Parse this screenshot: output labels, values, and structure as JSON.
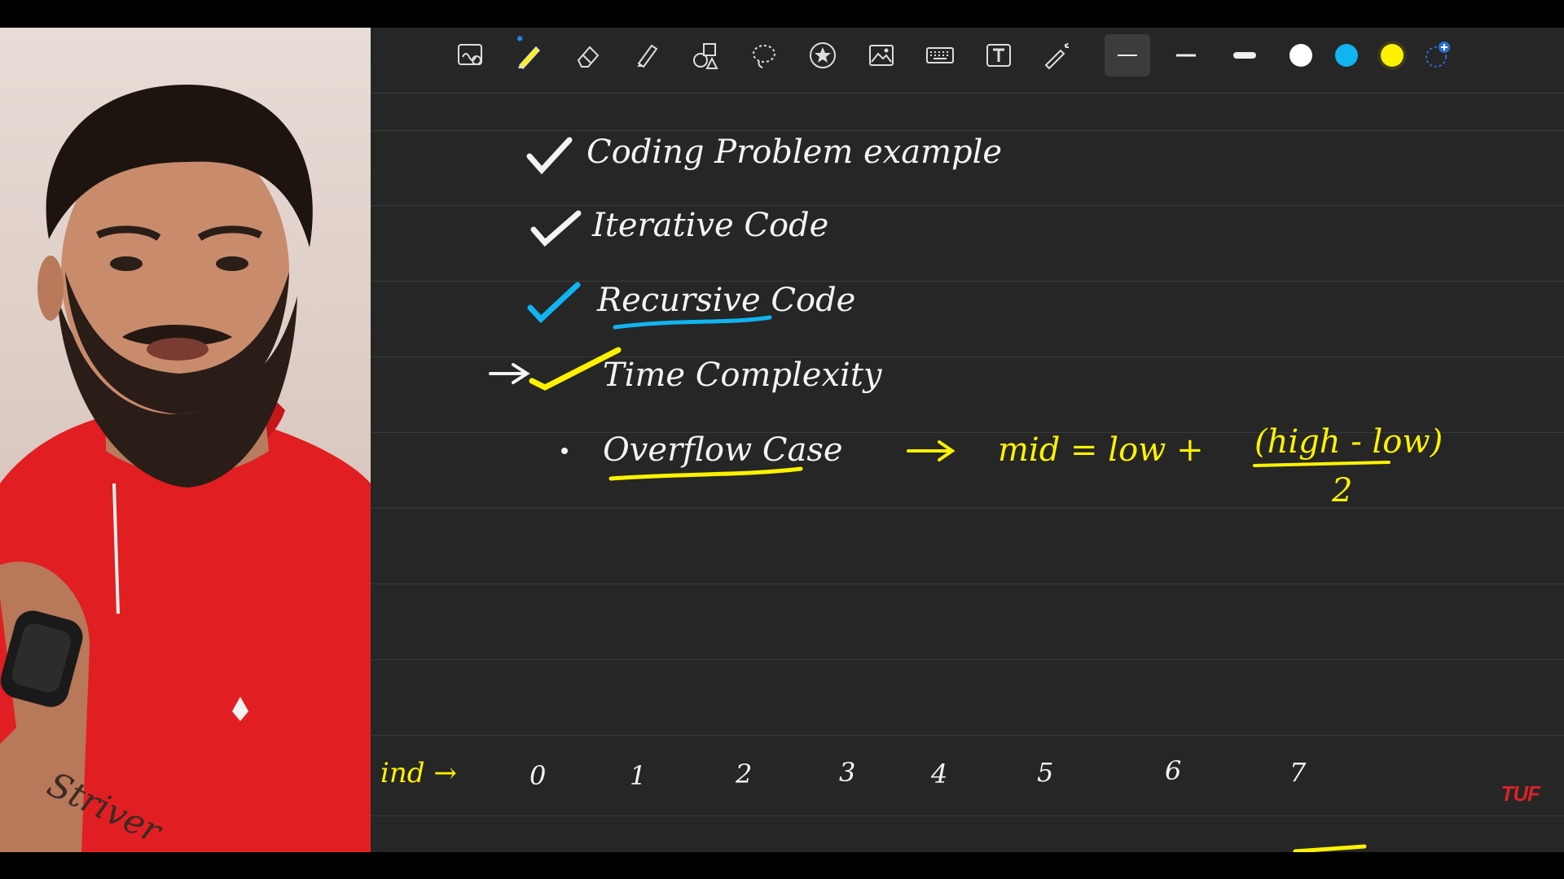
{
  "presenter": {
    "hoodie_color": "#e11f22",
    "background_color": "#e2d6d0",
    "tattoo_text": "Striver"
  },
  "toolbar": {
    "tools": [
      {
        "name": "zoom-write",
        "icon": "zoom-write-icon"
      },
      {
        "name": "pen",
        "icon": "pen-icon",
        "active": true
      },
      {
        "name": "eraser",
        "icon": "eraser-icon"
      },
      {
        "name": "highlighter",
        "icon": "highlighter-icon"
      },
      {
        "name": "shapes",
        "icon": "shapes-icon"
      },
      {
        "name": "lasso",
        "icon": "lasso-icon"
      },
      {
        "name": "stickers",
        "icon": "star-sticker-icon"
      },
      {
        "name": "image",
        "icon": "image-icon"
      },
      {
        "name": "keyboard",
        "icon": "keyboard-icon"
      },
      {
        "name": "text",
        "icon": "text-box-icon"
      },
      {
        "name": "laser-pointer",
        "icon": "laser-pointer-icon"
      }
    ],
    "stroke_widths": [
      "thin",
      "medium",
      "thick"
    ],
    "colors": [
      {
        "name": "white",
        "hex": "#ffffff"
      },
      {
        "name": "cyan",
        "hex": "#10b4f0"
      },
      {
        "name": "yellow",
        "hex": "#fff200",
        "selected": true
      }
    ],
    "add_color_icon": "add-color-icon"
  },
  "notes": {
    "lines": [
      {
        "text": "Coding Problem example",
        "color": "white"
      },
      {
        "text": "Iterative Code",
        "color": "white"
      },
      {
        "text": "Recursive Code",
        "color": "white"
      },
      {
        "text": "Time Complexity",
        "color": "white"
      },
      {
        "text": "Overflow Case",
        "color": "white"
      }
    ],
    "formula": {
      "lhs": "mid = low +",
      "numerator": "(high - low)",
      "denominator": "2"
    },
    "index_label": "ind →",
    "indices": [
      "0",
      "1",
      "2",
      "3",
      "4",
      "5",
      "6",
      "7"
    ]
  },
  "watermark": "TUF",
  "ink_colors": {
    "white": "#f4f4f4",
    "cyan": "#10b4f0",
    "yellow": "#fff200"
  }
}
